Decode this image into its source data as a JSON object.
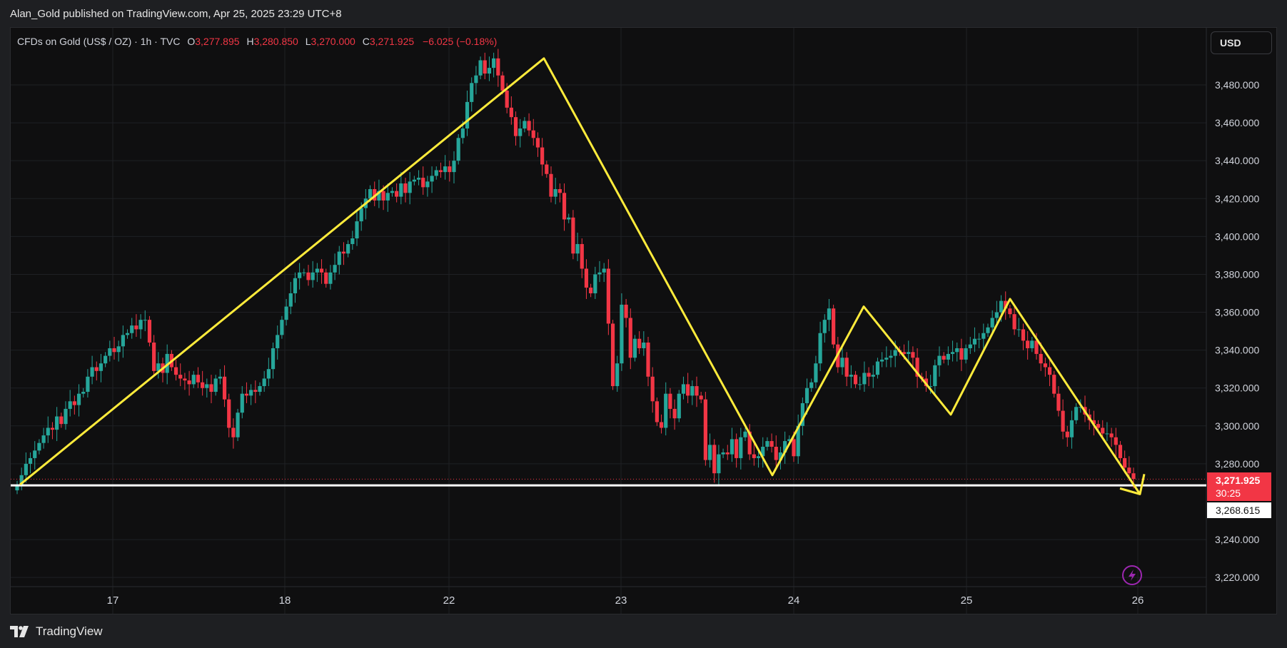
{
  "header": {
    "published_text": "Alan_Gold published on TradingView.com, Apr 25, 2025 23:29 UTC+8"
  },
  "legend": {
    "symbol": "CFDs on Gold (US$ / OZ) · 1h · TVC",
    "open_label": "O",
    "open_value": "3,277.895",
    "high_label": "H",
    "high_value": "3,280.850",
    "low_label": "L",
    "low_value": "3,270.000",
    "close_label": "C",
    "close_value": "3,271.925",
    "change": "−6.025 (−0.18%)"
  },
  "toolbar": {
    "currency_label": "USD"
  },
  "price_axis": {
    "labels": [
      "3,480.000",
      "3,460.000",
      "3,440.000",
      "3,420.000",
      "3,400.000",
      "3,380.000",
      "3,360.000",
      "3,340.000",
      "3,320.000",
      "3,300.000",
      "3,280.000",
      "3,240.000",
      "3,220.000"
    ],
    "current_price": "3,271.925",
    "countdown": "30:25",
    "level_price": "3,268.615"
  },
  "time_axis": {
    "labels": [
      "17",
      "18",
      "22",
      "23",
      "24",
      "25",
      "26"
    ]
  },
  "brand": {
    "name": "TradingView"
  },
  "colors": {
    "up": "#26a69a",
    "down": "#f23645",
    "pattern_line": "#ffeb3b",
    "support_line": "#ffffff",
    "background": "#0f0f10",
    "alert_icon": "#9c27b0"
  },
  "chart_data": {
    "type": "candlestick",
    "title": "CFDs on Gold (US$ / OZ) · 1h · TVC",
    "ylim": [
      3212,
      3504
    ],
    "x_ticks": [
      "17",
      "18",
      "22",
      "23",
      "24",
      "25",
      "26"
    ],
    "y_ticks": [
      3480,
      3460,
      3440,
      3420,
      3400,
      3380,
      3360,
      3340,
      3320,
      3300,
      3280,
      3240,
      3220
    ],
    "grid": true,
    "candles_close": [
      3269,
      3274,
      3280,
      3283,
      3287,
      3291,
      3295,
      3299,
      3298,
      3305,
      3301,
      3309,
      3313,
      3311,
      3317,
      3318,
      3326,
      3331,
      3329,
      3333,
      3337,
      3341,
      3339,
      3342,
      3348,
      3349,
      3353,
      3351,
      3356,
      3356,
      3344,
      3329,
      3333,
      3328,
      3338,
      3331,
      3327,
      3325,
      3324,
      3322,
      3327,
      3323,
      3320,
      3322,
      3318,
      3325,
      3326,
      3314,
      3299,
      3294,
      3307,
      3317,
      3316,
      3319,
      3318,
      3321,
      3325,
      3330,
      3341,
      3348,
      3356,
      3363,
      3370,
      3378,
      3381,
      3381,
      3377,
      3381,
      3383,
      3381,
      3375,
      3381,
      3385,
      3392,
      3391,
      3396,
      3399,
      3408,
      3415,
      3420,
      3425,
      3419,
      3424,
      3419,
      3423,
      3424,
      3421,
      3428,
      3423,
      3429,
      3430,
      3431,
      3426,
      3429,
      3432,
      3435,
      3434,
      3437,
      3434,
      3440,
      3452,
      3457,
      3471,
      3481,
      3485,
      3493,
      3486,
      3489,
      3494,
      3485,
      3477,
      3468,
      3463,
      3453,
      3457,
      3461,
      3456,
      3452,
      3447,
      3438,
      3433,
      3421,
      3425,
      3423,
      3409,
      3410,
      3391,
      3396,
      3383,
      3373,
      3370,
      3380,
      3381,
      3383,
      3354,
      3321,
      3333,
      3364,
      3357,
      3336,
      3346,
      3341,
      3344,
      3326,
      3313,
      3302,
      3299,
      3317,
      3309,
      3304,
      3317,
      3322,
      3316,
      3321,
      3316,
      3314,
      3282,
      3290,
      3275,
      3285,
      3286,
      3285,
      3293,
      3283,
      3294,
      3297,
      3285,
      3283,
      3284,
      3289,
      3292,
      3289,
      3282,
      3286,
      3292,
      3293,
      3284,
      3300,
      3312,
      3320,
      3323,
      3333,
      3349,
      3356,
      3362,
      3343,
      3331,
      3336,
      3326,
      3327,
      3322,
      3322,
      3328,
      3326,
      3327,
      3334,
      3335,
      3336,
      3337,
      3340,
      3339,
      3338,
      3339,
      3336,
      3326,
      3325,
      3321,
      3321,
      3332,
      3337,
      3335,
      3338,
      3339,
      3341,
      3335,
      3341,
      3343,
      3346,
      3346,
      3349,
      3352,
      3357,
      3360,
      3366,
      3362,
      3359,
      3351,
      3351,
      3345,
      3341,
      3345,
      3338,
      3333,
      3331,
      3327,
      3317,
      3308,
      3297,
      3294,
      3303,
      3310,
      3310,
      3306,
      3303,
      3301,
      3299,
      3296,
      3296,
      3294,
      3290,
      3283,
      3278,
      3275,
      3272
    ],
    "pattern_line": [
      {
        "time": "Apr 16",
        "price": 3269
      },
      {
        "time": "Apr 22",
        "price": 3494
      },
      {
        "time": "Apr 23",
        "price": 3274
      },
      {
        "time": "Apr 24",
        "price": 3363
      },
      {
        "time": "Apr 24",
        "price": 3306
      },
      {
        "time": "Apr 25",
        "price": 3367
      },
      {
        "time": "Apr 25",
        "price": 3264
      }
    ],
    "support_level": 3268.615,
    "last_price": 3271.925
  }
}
